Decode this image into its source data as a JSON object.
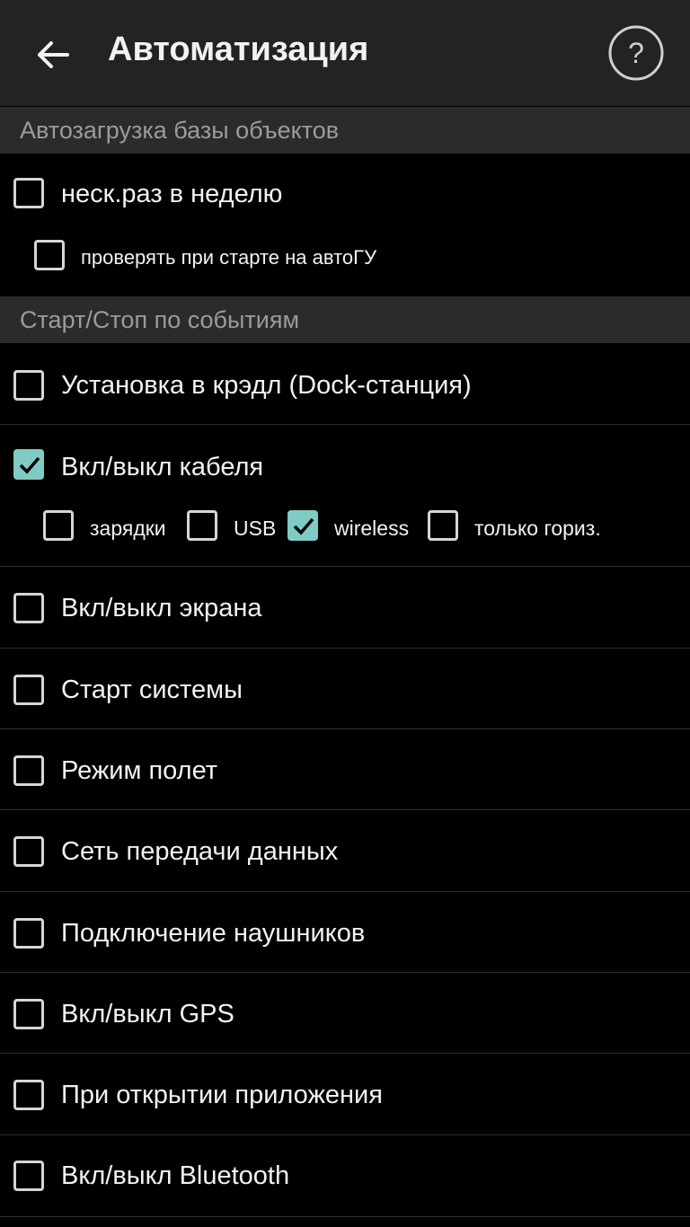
{
  "header": {
    "title": "Автоматизация",
    "back_icon": "arrow-left-icon",
    "help_icon": "help-circle-icon",
    "help_glyph": "?"
  },
  "sections": [
    {
      "title": "Автозагрузка базы объектов"
    },
    {
      "title": "Старт/Стоп по событиям"
    }
  ],
  "autoload": {
    "weekly": {
      "label": "неск.раз в неделю",
      "checked": false
    },
    "check_on_start": {
      "label": "проверять при старте на автоГУ",
      "checked": false
    }
  },
  "events": {
    "dock": {
      "label": "Установка в крэдл (Dock-станция)",
      "checked": false
    },
    "cable": {
      "label": "Вкл/выкл кабеля",
      "checked": true,
      "options": [
        {
          "label": "зарядки",
          "checked": false
        },
        {
          "label": "USB",
          "checked": false
        },
        {
          "label": "wireless",
          "checked": true
        },
        {
          "label": "только гориз.",
          "checked": false
        }
      ]
    },
    "screen": {
      "label": "Вкл/выкл экрана",
      "checked": false
    },
    "system_start": {
      "label": "Старт системы",
      "checked": false
    },
    "airplane": {
      "label": "Режим полет",
      "checked": false
    },
    "data_network": {
      "label": "Сеть передачи данных",
      "checked": false
    },
    "headphones": {
      "label": "Подключение наушников",
      "checked": false
    },
    "gps": {
      "label": "Вкл/выкл GPS",
      "checked": false
    },
    "app_open": {
      "label": "При открытии приложения",
      "checked": false
    },
    "bluetooth": {
      "label": "Вкл/выкл Bluetooth",
      "checked": false
    }
  },
  "colors": {
    "accent": "#80cbc4",
    "toolbar": "#232323",
    "section": "#2b2b2b",
    "background": "#000000"
  }
}
